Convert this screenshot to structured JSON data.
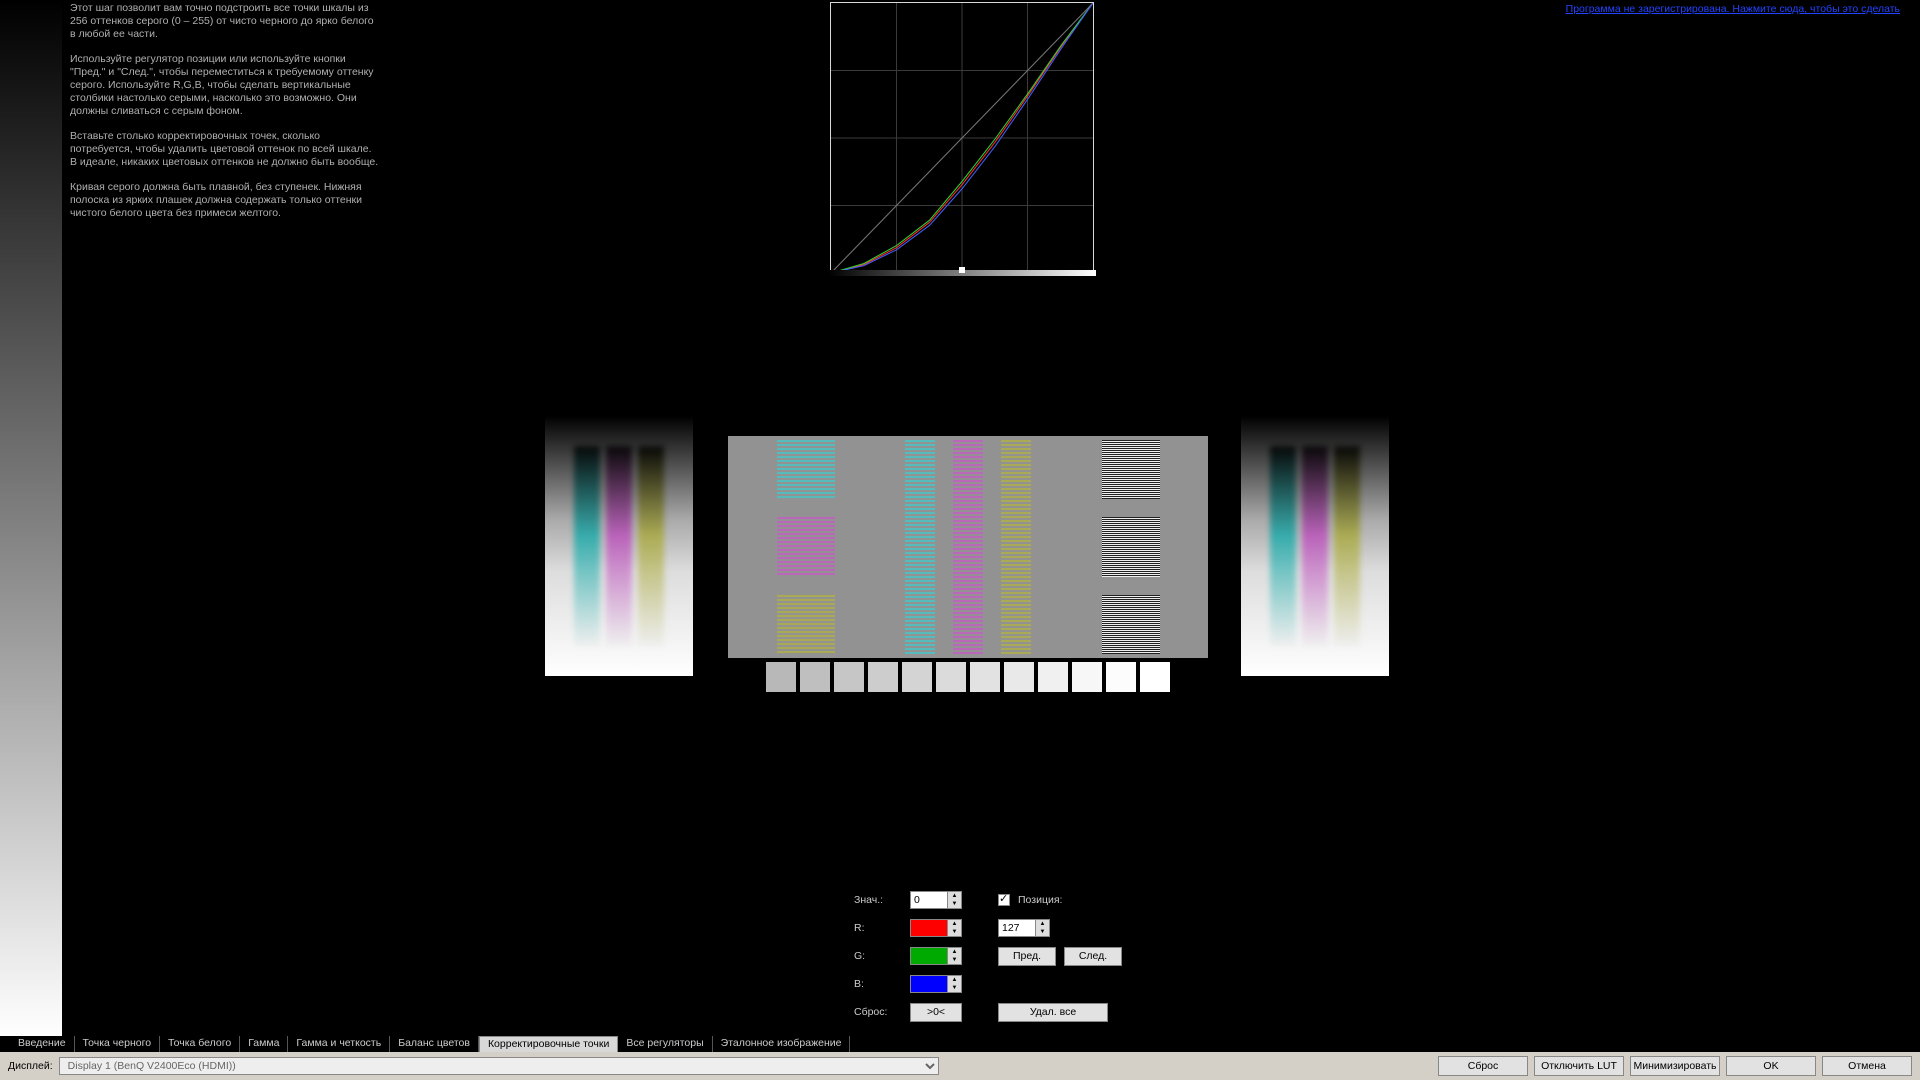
{
  "registration_link": "Программа не зарегистрирована. Нажмите сюда, чтобы это сделать",
  "instructions": {
    "p1": "Этот шаг позволит вам точно подстроить все точки шкалы из 256 оттенков серого (0 – 255) от чисто черного до ярко белого в любой ее части.",
    "p2": "Используйте регулятор позиции или используйте кнопки \"Пред.\" и \"След.\", чтобы переместиться к требуемому оттенку серого. Используйте R,G,B, чтобы сделать вертикальные столбики настолько серыми, насколько это возможно. Они должны сливаться с серым фоном.",
    "p3": "Вставьте столько корректировочных точек, сколько потребуется, чтобы удалить цветовой оттенок по всей шкале. В идеале, никаких цветовых оттенков не должно быть вообще.",
    "p4": "Кривая серого должна быть плавной, без ступенек. Нижняя полоска из ярких плашек должна содержать только оттенки чистого белого цвета без примеси желтого."
  },
  "swatches": [
    "#b8b8b8",
    "#bfbfbf",
    "#c6c6c6",
    "#cdcdcd",
    "#d4d4d4",
    "#dbdbdb",
    "#e2e2e2",
    "#e9e9e9",
    "#f0f0f0",
    "#f7f7f7",
    "#fcfcfc",
    "#ffffff"
  ],
  "controls": {
    "value_label": "Знач.:",
    "value": "0",
    "r_label": "R:",
    "g_label": "G:",
    "b_label": "B:",
    "reset_label": "Сброс:",
    "position_label": "Позиция:",
    "position_checked": true,
    "position": "127",
    "prev": "Пред.",
    "next": "След.",
    "reset_point": ">0<",
    "delete_all": "Удал. все"
  },
  "tabs": [
    "Введение",
    "Точка черного",
    "Точка белого",
    "Гамма",
    "Гамма и четкость",
    "Баланс цветов",
    "Корректировочные точки",
    "Все регуляторы",
    "Эталонное изображение"
  ],
  "active_tab_index": 6,
  "footer": {
    "display_label": "Дисплей:",
    "display_value": "Display 1 (BenQ V2400Eco (HDMI))",
    "reset": "Сброс",
    "disable_lut": "Отключить LUT",
    "minimize": "Минимизировать",
    "ok": "OK",
    "cancel": "Отмена"
  },
  "chart_data": {
    "type": "line",
    "title": "",
    "xlabel": "",
    "ylabel": "",
    "xlim": [
      0,
      255
    ],
    "ylim": [
      0,
      255
    ],
    "series": [
      {
        "name": "reference-linear",
        "color": "#777",
        "x": [
          0,
          255
        ],
        "y": [
          0,
          255
        ]
      },
      {
        "name": "red",
        "color": "#ff3030",
        "x": [
          0,
          32,
          64,
          96,
          128,
          160,
          192,
          224,
          255
        ],
        "y": [
          0,
          8,
          24,
          48,
          84,
          124,
          168,
          214,
          255
        ]
      },
      {
        "name": "green",
        "color": "#30d030",
        "x": [
          0,
          32,
          64,
          96,
          128,
          160,
          192,
          224,
          255
        ],
        "y": [
          0,
          9,
          26,
          50,
          87,
          127,
          170,
          215,
          255
        ]
      },
      {
        "name": "blue",
        "color": "#4060ff",
        "x": [
          0,
          32,
          64,
          96,
          128,
          160,
          192,
          224,
          255
        ],
        "y": [
          0,
          7,
          22,
          45,
          80,
          120,
          165,
          212,
          255
        ]
      }
    ],
    "control_point_marker": 127
  }
}
